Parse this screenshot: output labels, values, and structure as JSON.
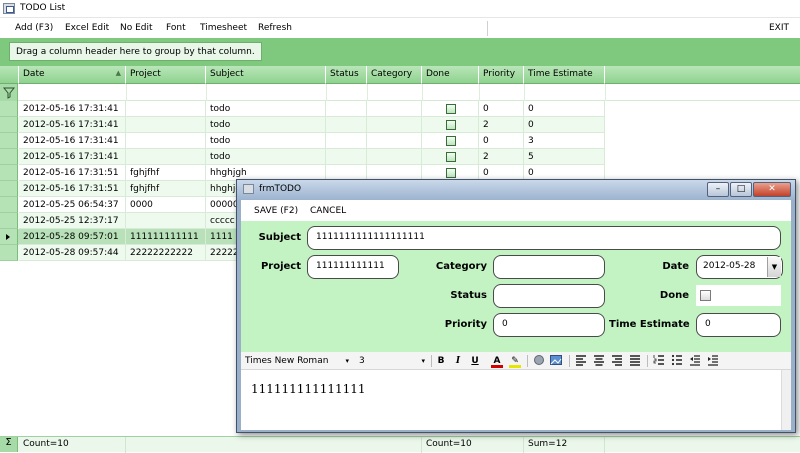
{
  "window": {
    "title": "TODO List"
  },
  "menu": {
    "items": [
      "Add (F3)",
      "Excel Edit",
      "No Edit",
      "Font",
      "Timesheet",
      "Refresh"
    ],
    "exit": "EXIT"
  },
  "group_panel": {
    "hint": "Drag a column header here to group by that column."
  },
  "grid": {
    "columns": [
      "Date",
      "Project",
      "Subject",
      "Status",
      "Category",
      "Done",
      "Priority",
      "Time Estimate"
    ],
    "rows": [
      [
        "2012-05-16 17:31:41",
        "",
        "todo",
        "",
        "",
        "",
        "0",
        "0"
      ],
      [
        "2012-05-16 17:31:41",
        "",
        "todo",
        "",
        "",
        "",
        "2",
        "0"
      ],
      [
        "2012-05-16 17:31:41",
        "",
        "todo",
        "",
        "",
        "",
        "0",
        "3"
      ],
      [
        "2012-05-16 17:31:41",
        "",
        "todo",
        "",
        "",
        "",
        "2",
        "5"
      ],
      [
        "2012-05-16 17:31:51",
        "fghjfhf",
        "hhghjgh",
        "",
        "",
        "",
        "0",
        "0"
      ],
      [
        "2012-05-16 17:31:51",
        "fghjfhf",
        "hhghjgh",
        "",
        "",
        "",
        "",
        ""
      ],
      [
        "2012-05-25 06:54:37",
        "0000",
        "00000",
        "",
        "",
        "",
        "",
        ""
      ],
      [
        "2012-05-25 12:37:17",
        "",
        "ccccc",
        "",
        "",
        "",
        "",
        ""
      ],
      [
        "2012-05-28 09:57:01",
        "111111111111",
        "1111",
        "",
        "",
        "",
        "",
        ""
      ],
      [
        "2012-05-28 09:57:44",
        "22222222222",
        "22222",
        "",
        "",
        "",
        "",
        ""
      ]
    ],
    "selected_row": 8,
    "footer": {
      "count_date": "Count=10",
      "count_done": "Count=10",
      "sum_time": "Sum=12"
    }
  },
  "dialog": {
    "title": "frmTODO",
    "menu": {
      "save": "SAVE (F2)",
      "cancel": "CANCEL"
    },
    "labels": {
      "subject": "Subject",
      "project": "Project",
      "category": "Category",
      "date": "Date",
      "status": "Status",
      "done": "Done",
      "priority": "Priority",
      "time_estimate": "Time Estimate"
    },
    "values": {
      "subject": "1111111111111111111",
      "project": "111111111111",
      "category": "",
      "date": "2012-05-28",
      "status": "",
      "priority": "0",
      "time_estimate": "0"
    },
    "editor": {
      "font": "Times New Roman",
      "size": "3",
      "text": "111111111111111"
    }
  },
  "colors": {
    "grid_header": "#a8dca8",
    "form_background": "#c3f3c3",
    "group_panel": "#7fc97f"
  }
}
